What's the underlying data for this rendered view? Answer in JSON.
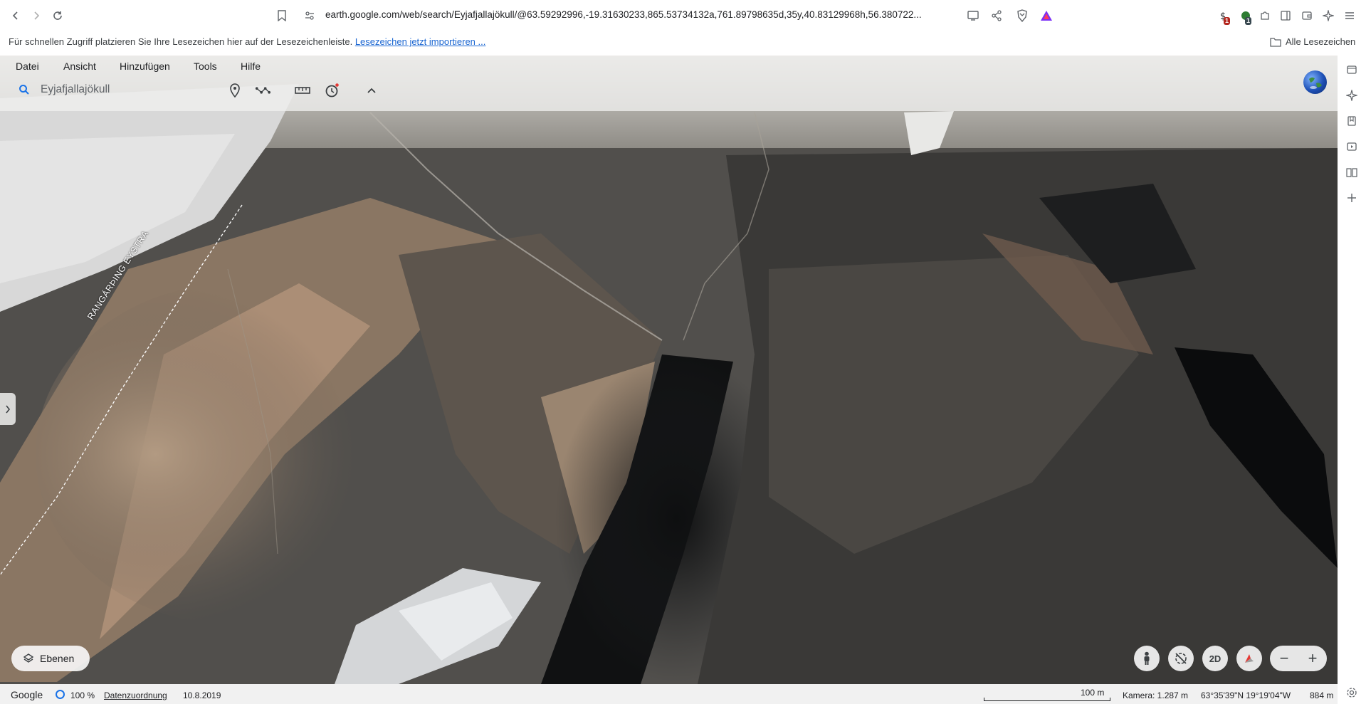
{
  "browser": {
    "url": "earth.google.com/web/search/Eyjafjallajökull/@63.59292996,-19.31630233,865.53734132a,761.89798635d,35y,40.83129968h,56.380722...",
    "extension_badge_1": "1",
    "extension_badge_2": "1"
  },
  "bookmarks_bar": {
    "hint": "Für schnellen Zugriff platzieren Sie Ihre Lesezeichen hier auf der Lesezeichenleiste.",
    "import_link": "Lesezeichen jetzt importieren ...",
    "all_bookmarks": "Alle Lesezeichen"
  },
  "earth": {
    "menu": [
      "Datei",
      "Ansicht",
      "Hinzufügen",
      "Tools",
      "Hilfe"
    ],
    "search_value": "Eyjafjallajökull",
    "map_label": "RANGÁRÞING EYSTRA",
    "layers_button": "Ebenen",
    "view_2d": "2D",
    "zoom_out": "−",
    "zoom_in": "+"
  },
  "status": {
    "google": "Google",
    "percent": "100 %",
    "data_attribution": "Datenzuordnung",
    "date": "10.8.2019",
    "scale": "100 m",
    "camera": "Kamera: 1.287 m",
    "coords": "63°35'39\"N 19°19'04\"W",
    "elevation": "884 m"
  },
  "colors": {
    "accent": "#1a73e8",
    "link": "#1a66d2"
  }
}
